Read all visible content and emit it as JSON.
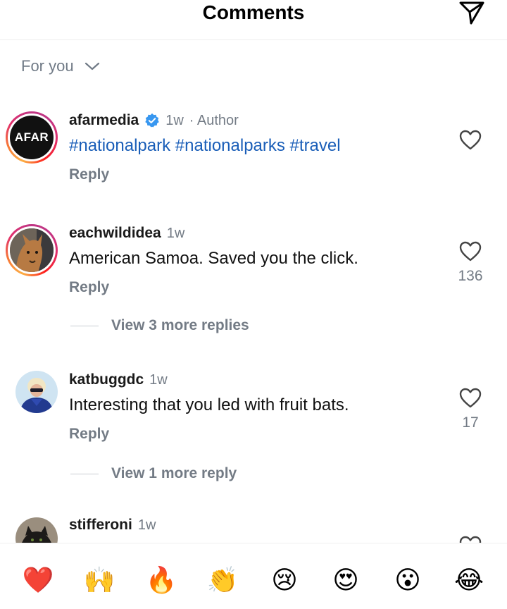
{
  "header": {
    "title": "Comments",
    "send_icon": "paper-plane-icon"
  },
  "filter": {
    "label": "For you",
    "icon": "chevron-down-icon"
  },
  "comments": [
    {
      "username": "afarmedia",
      "verified": true,
      "time": "1w",
      "author_tag": "· Author",
      "text": "#nationalpark #nationalparks #travel",
      "reply_label": "Reply",
      "avatar_text": "AFAR",
      "likes": ""
    },
    {
      "username": "eachwildidea",
      "time": "1w",
      "text": "American Samoa. Saved you the click.",
      "reply_label": "Reply",
      "likes": "136",
      "view_more": "View 3 more replies"
    },
    {
      "username": "katbuggdc",
      "time": "1w",
      "text": "Interesting that you led with fruit bats.",
      "reply_label": "Reply",
      "likes": "17",
      "view_more": "View 1 more reply"
    },
    {
      "username": "stifferoni",
      "time": "1w"
    }
  ],
  "emoji_bar": [
    {
      "glyph": "❤️",
      "name": "red-heart"
    },
    {
      "glyph": "🙌",
      "name": "raising-hands"
    },
    {
      "glyph": "🔥",
      "name": "fire"
    },
    {
      "glyph": "👏",
      "name": "clapping-hands"
    },
    {
      "glyph": "😢",
      "name": "crying-face"
    },
    {
      "glyph": "😍",
      "name": "heart-eyes"
    },
    {
      "glyph": "😮",
      "name": "surprised-face"
    },
    {
      "glyph": "😂",
      "name": "tears-of-joy"
    }
  ],
  "colors": {
    "link_blue": "#1a5eb8",
    "muted_gray": "#737b85",
    "verified_blue": "#3897f0"
  }
}
